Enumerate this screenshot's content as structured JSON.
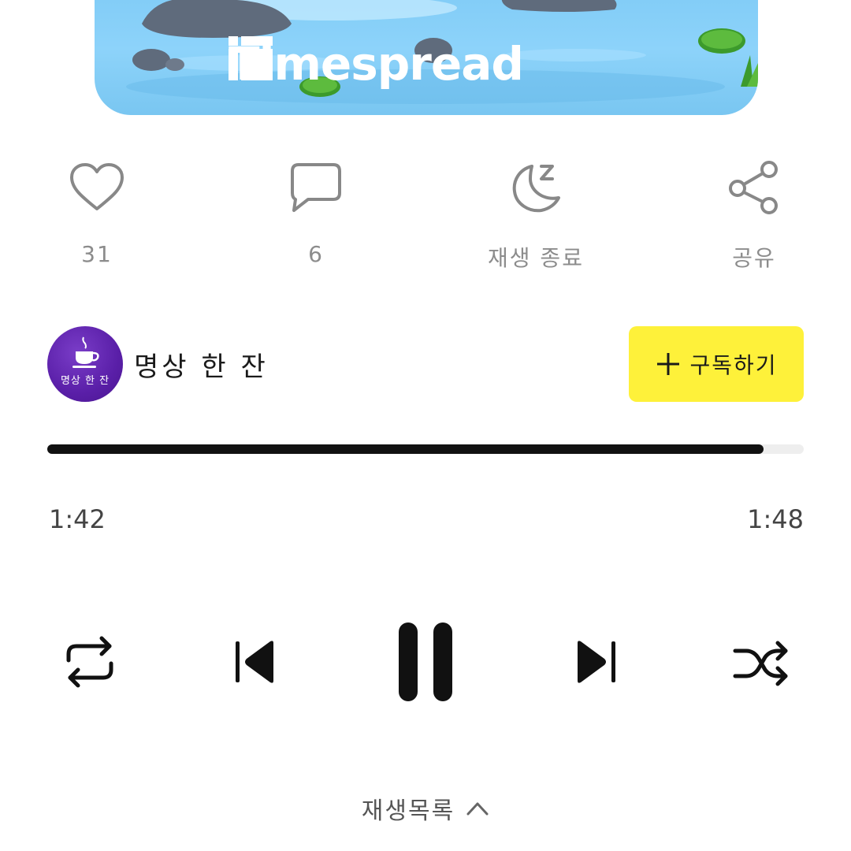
{
  "artwork": {
    "watermark_text": "Timespread",
    "icons": [
      "pond-illustration",
      "timespread-logo-icon"
    ]
  },
  "actions": {
    "like": {
      "count": "31",
      "icon": "heart-icon"
    },
    "comment": {
      "count": "6",
      "icon": "comment-icon"
    },
    "sleep_timer": {
      "label": "재생 종료",
      "icon": "moon-sleep-icon"
    },
    "share": {
      "label": "공유",
      "icon": "share-icon"
    }
  },
  "channel": {
    "name": "명상 한 잔",
    "avatar_text": "명상 한 잔",
    "subscribe_label": "구독하기",
    "subscribe_color": "#fef13a",
    "avatar_color": "#5a1fa8"
  },
  "playback": {
    "elapsed": "1:42",
    "duration": "1:48",
    "progress_fraction": 0.947
  },
  "controls": {
    "icons": [
      "repeat-icon",
      "skip-previous-icon",
      "pause-icon",
      "skip-next-icon",
      "shuffle-icon"
    ]
  },
  "playlist": {
    "label": "재생목록",
    "icon": "chevron-up-icon"
  }
}
